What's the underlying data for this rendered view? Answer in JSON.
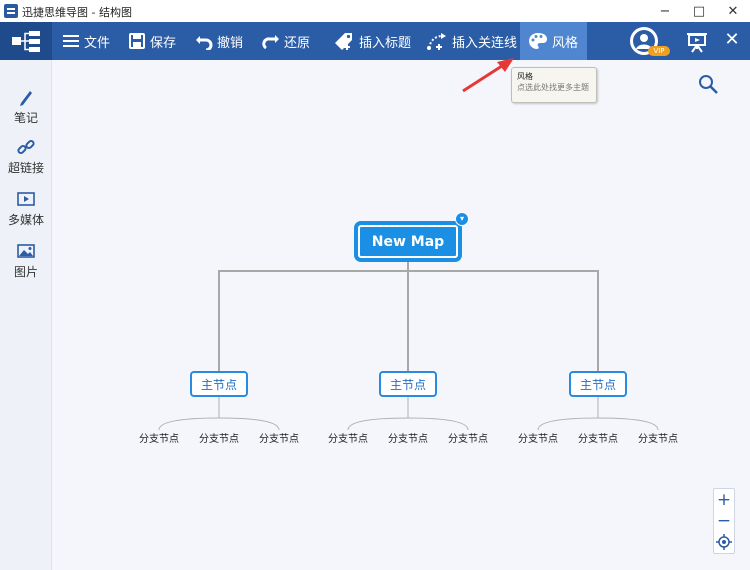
{
  "window": {
    "title": "迅捷思维导图 - 结构图",
    "minimize": "−",
    "maximize": "□",
    "close": "✕"
  },
  "toolbar": {
    "items": [
      {
        "label": "文件",
        "icon": "menu-icon"
      },
      {
        "label": "保存",
        "icon": "save-icon"
      },
      {
        "label": "撤销",
        "icon": "undo-icon"
      },
      {
        "label": "还原",
        "icon": "redo-icon"
      },
      {
        "label": "插入标题",
        "icon": "tag-icon"
      },
      {
        "label": "插入关连线",
        "icon": "connector-icon"
      },
      {
        "label": "风格",
        "icon": "palette-icon"
      }
    ],
    "active": "风格",
    "vip_badge": "VIP",
    "close": "✕"
  },
  "tooltip": {
    "title": "风格",
    "description": "点选此处找更多主题"
  },
  "sidebar": {
    "items": [
      {
        "label": "笔记",
        "icon": "pen-icon"
      },
      {
        "label": "超链接",
        "icon": "link-icon"
      },
      {
        "label": "多媒体",
        "icon": "media-icon"
      },
      {
        "label": "图片",
        "icon": "image-icon"
      }
    ]
  },
  "mindmap": {
    "root": "New Map",
    "collapse": "▾",
    "main_nodes": [
      {
        "label": "主节点",
        "children": [
          "分支节点",
          "分支节点",
          "分支节点"
        ]
      },
      {
        "label": "主节点",
        "children": [
          "分支节点",
          "分支节点",
          "分支节点"
        ]
      },
      {
        "label": "主节点",
        "children": [
          "分支节点",
          "分支节点",
          "分支节点"
        ]
      }
    ]
  },
  "zoom": {
    "in": "+",
    "out": "−"
  },
  "colors": {
    "toolbar": "#2b5ca6",
    "accent": "#1a8fe3",
    "canvas": "#f4f6fc",
    "arrow": "#e53935"
  }
}
